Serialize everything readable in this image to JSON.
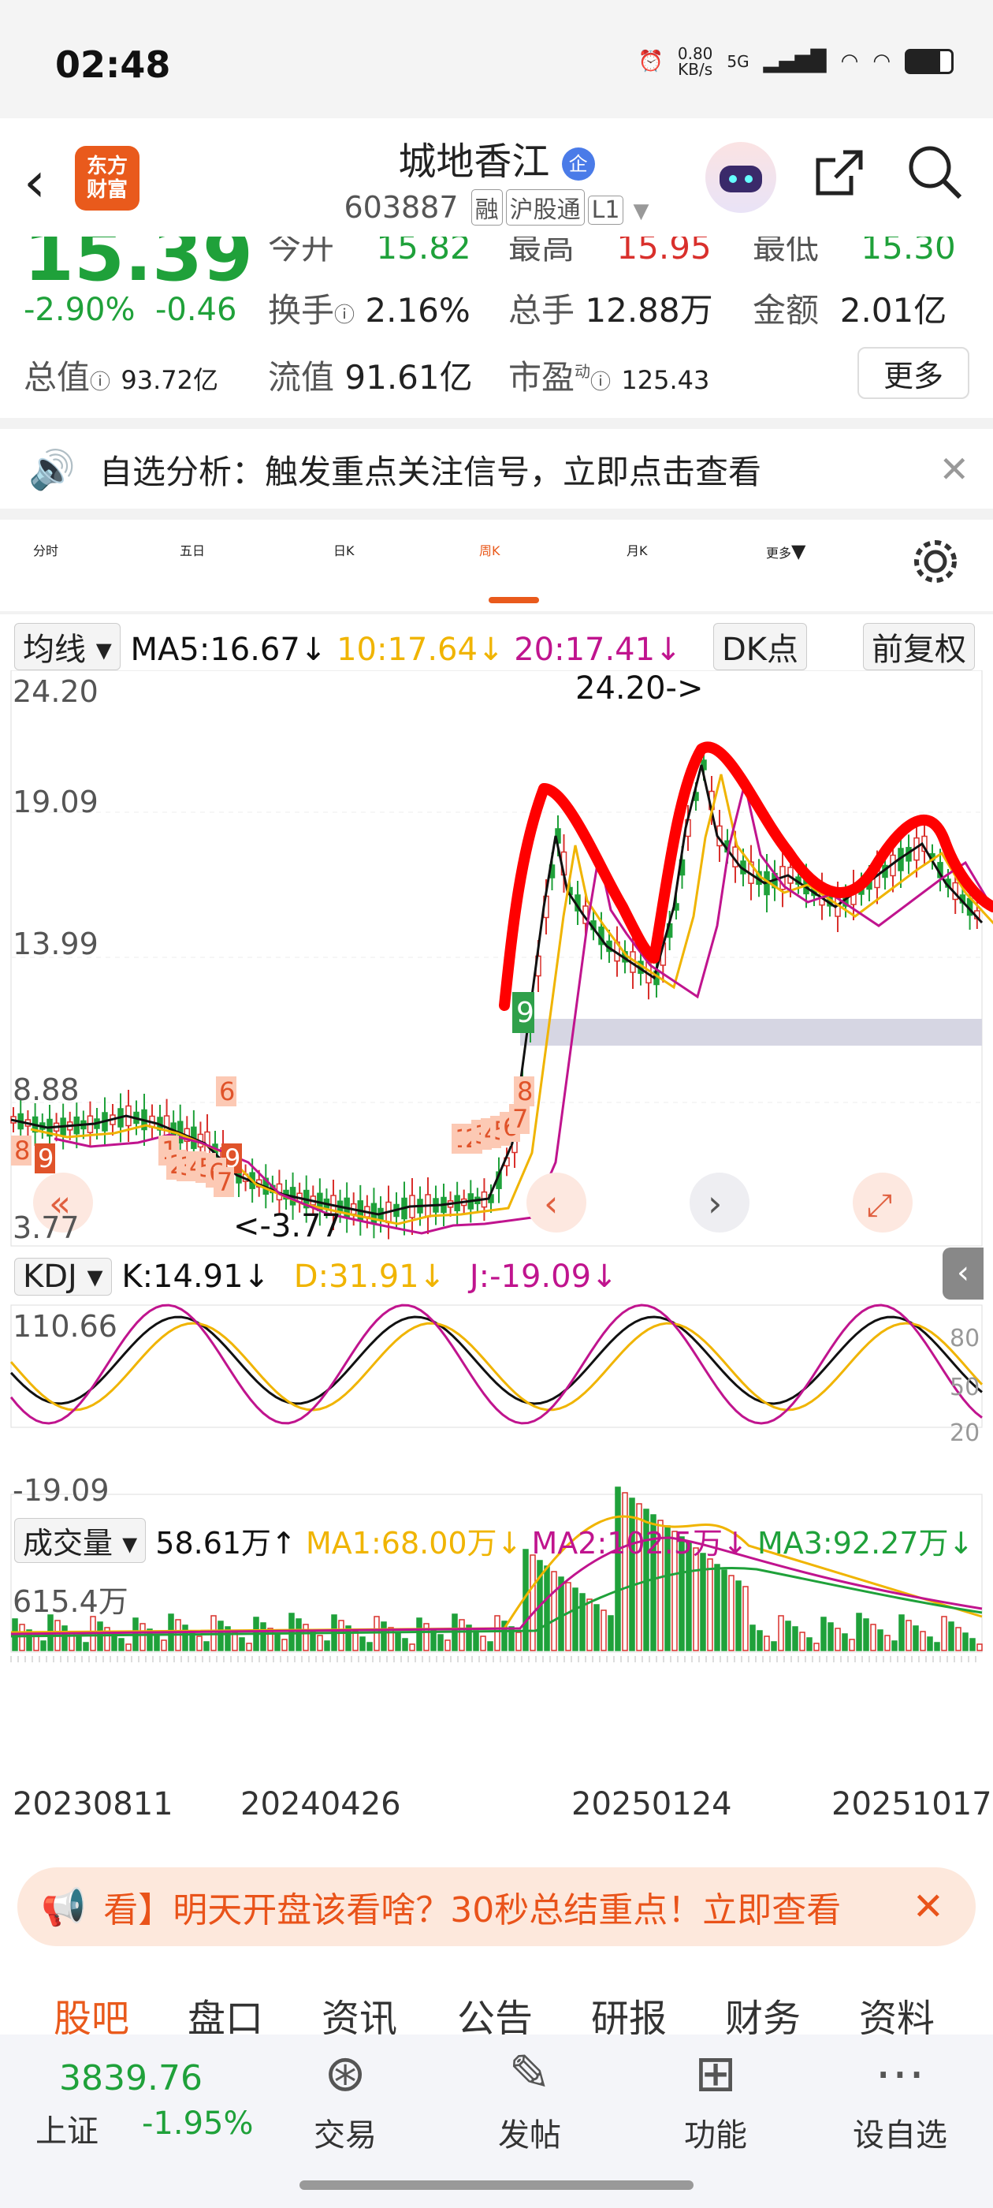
{
  "status_bar": {
    "time": "02:48",
    "net_speed": "0.80\nKB/s",
    "network": "5G"
  },
  "header": {
    "logo_text": "东方\n财富",
    "stock_name": "城地香江",
    "badge": "企",
    "code": "603887",
    "tags": [
      "融",
      "沪股通",
      "L1"
    ]
  },
  "quote": {
    "price": "15.39",
    "pct_change": "-2.90%",
    "change": "-0.46",
    "row0": {
      "open_label": "今开",
      "open_value": "15.82",
      "high_label": "最高",
      "high_value": "15.95",
      "low_label": "最低",
      "low_value": "15.30"
    },
    "row1": {
      "turnover_label": "换手",
      "turnover_value": "2.16%",
      "volume_label": "总手",
      "volume_value": "12.88万",
      "amount_label": "金额",
      "amount_value": "2.01亿"
    },
    "row2": {
      "mcap_label": "总值",
      "mcap_value": "93.72亿",
      "float_label": "流值",
      "float_value": "91.61亿",
      "pe_label": "市盈",
      "pe_sup": "动",
      "pe_value": "125.43"
    },
    "more_label": "更多"
  },
  "alert": {
    "text": "自选分析：触发重点关注信号，立即点击查看"
  },
  "period_tabs": [
    "分时",
    "五日",
    "日K",
    "周K",
    "月K",
    "更多"
  ],
  "active_tab": "周K",
  "kline_legend": {
    "selector": "均线",
    "ma5": "MA5:16.67↓",
    "ma10": "10:17.64↓",
    "ma20": "20:17.41↓",
    "dk": "DK点",
    "adj": "前复权"
  },
  "kline": {
    "y_ticks": [
      "24.20",
      "19.09",
      "13.99",
      "8.88",
      "3.77"
    ],
    "high_marker": "24.20->",
    "low_marker": "<-3.77",
    "signal_9": "9",
    "seq_nums": [
      "8",
      "9",
      "6",
      "9",
      "1",
      "2",
      "3",
      "4",
      "5",
      "6",
      "7",
      "1",
      "2",
      "3",
      "4",
      "5",
      "6",
      "7",
      "8"
    ],
    "x_ticks": [
      "20230811",
      "20240426",
      "20250124",
      "20251017"
    ]
  },
  "kdj": {
    "selector": "KDJ",
    "k": "K:14.91↓",
    "d": "D:31.91↓",
    "j": "J:-19.09↓",
    "y_top": "110.66",
    "y_bottom": "-19.09",
    "right_ticks": [
      "80",
      "50",
      "20"
    ]
  },
  "volume": {
    "selector": "成交量",
    "value": "58.61万↑",
    "ma1": "MA1:68.00万↓",
    "ma2": "MA2:102.5万↓",
    "ma3": "MA3:92.27万↓",
    "y_top": "615.4万"
  },
  "colors": {
    "up": "#d9302c",
    "down": "#1fa13a",
    "ma5": "#111111",
    "ma10": "#f0b400",
    "ma20": "#c0148e",
    "brand": "#e95a1c",
    "hand_drawn": "#ff0000"
  },
  "banner": {
    "text": "看】明天开盘该看啥？30秒总结重点！立即查看"
  },
  "bottom_tabs": [
    "股吧",
    "盘口",
    "资讯",
    "公告",
    "研报",
    "财务",
    "资料"
  ],
  "bottom_nav": {
    "index_value": "3839.76",
    "index_name": "上证",
    "index_change": "-1.95%",
    "items": [
      "交易",
      "发帖",
      "功能",
      "设自选"
    ]
  }
}
